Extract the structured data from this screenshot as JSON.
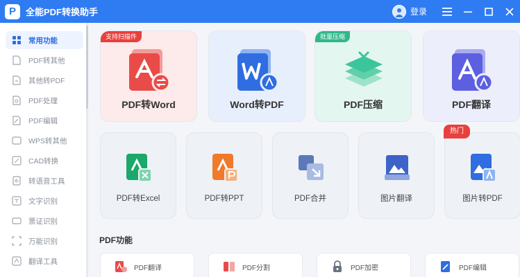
{
  "app": {
    "title": "全能PDF转换助手",
    "logo_letter": "P",
    "login_label": "登录",
    "controls": [
      "menu-icon",
      "minimize-icon",
      "maximize-icon",
      "close-icon"
    ]
  },
  "sidebar": {
    "items": [
      {
        "label": "常用功能",
        "icon": "home-icon",
        "active": true
      },
      {
        "label": "PDF转其他",
        "icon": "pdf-convert-icon",
        "active": false
      },
      {
        "label": "其他转PDF",
        "icon": "to-pdf-icon",
        "active": false
      },
      {
        "label": "PDF处理",
        "icon": "pdf-process-icon",
        "active": false
      },
      {
        "label": "PDF编辑",
        "icon": "pdf-edit-icon",
        "active": false
      },
      {
        "label": "WPS转其他",
        "icon": "wps-icon",
        "active": false
      },
      {
        "label": "CAD转换",
        "icon": "cad-icon",
        "active": false
      },
      {
        "label": "转语音工具",
        "icon": "voice-icon",
        "active": false
      },
      {
        "label": "文字识别",
        "icon": "ocr-icon",
        "active": false
      },
      {
        "label": "票证识别",
        "icon": "ticket-icon",
        "active": false
      },
      {
        "label": "万能识别",
        "icon": "universal-scan-icon",
        "active": false
      },
      {
        "label": "翻译工具",
        "icon": "translate-icon",
        "active": false
      }
    ]
  },
  "feature_cards": [
    {
      "label": "PDF转Word",
      "tag": "支持扫描件",
      "bg": "#fdeaea",
      "icon_color": "#e94b48"
    },
    {
      "label": "Word转PDF",
      "tag": "",
      "bg": "#e8effc",
      "icon_color": "#2f6de1"
    },
    {
      "label": "PDF压缩",
      "tag": "批量压缩",
      "bg": "#e3f6ef",
      "icon_color": "#3cc49a"
    },
    {
      "label": "PDF翻译",
      "tag": "",
      "bg": "#eceefb",
      "icon_color": "#5b5fe0"
    }
  ],
  "tool_cards": [
    {
      "label": "PDF转Excel",
      "tag": "",
      "icon_color": "#1aa86b"
    },
    {
      "label": "PDF转PPT",
      "tag": "",
      "icon_color": "#f07a2b"
    },
    {
      "label": "PDF合并",
      "tag": "",
      "icon_color": "#5c78b8"
    },
    {
      "label": "图片翻译",
      "tag": "",
      "icon_color": "#3d63c9"
    },
    {
      "label": "图片转PDF",
      "tag": "热门",
      "icon_color": "#2f6de1"
    }
  ],
  "pdf_section": {
    "title": "PDF功能",
    "items": [
      {
        "label": "PDF翻译",
        "icon_color": "#e94b48"
      },
      {
        "label": "PDF分割",
        "icon_color": "#e94b48"
      },
      {
        "label": "PDF加密",
        "icon_color": "#6b7280"
      },
      {
        "label": "PDF编辑",
        "icon_color": "#2f6de1"
      }
    ]
  },
  "colors": {
    "accent": "#2f7bf2",
    "tag_red": "#e8403d",
    "tag_green": "#2fb889"
  }
}
